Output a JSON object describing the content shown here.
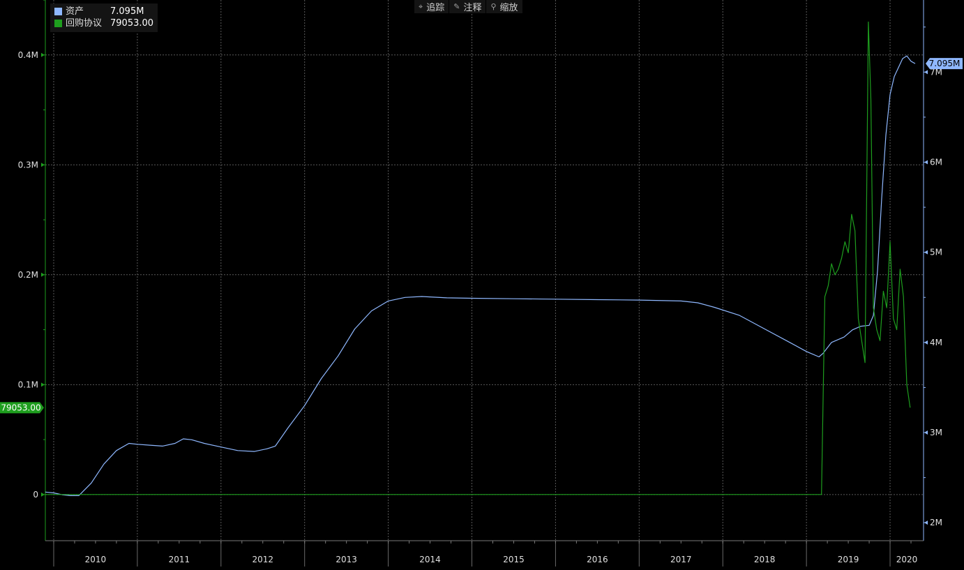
{
  "legend": {
    "items": [
      {
        "name": "资产",
        "value": "7.095M",
        "color": "#8fb8ff"
      },
      {
        "name": "回购协议",
        "value": "79053.00",
        "color": "#1e9e1e"
      }
    ]
  },
  "toolbar": {
    "crosshair_label": "追踪",
    "crosshair_icon": "crosshair-icon",
    "annotate_label": "注释",
    "annotate_icon": "pencil-icon",
    "zoom_label": "缩放",
    "zoom_icon": "magnifier-icon"
  },
  "chart_data": {
    "type": "line",
    "title": "",
    "x_ticks": [
      "2010",
      "2011",
      "2012",
      "2013",
      "2014",
      "2015",
      "2016",
      "2017",
      "2018",
      "2019",
      "2020"
    ],
    "xlim": [
      2009.9,
      2020.4
    ],
    "grid": true,
    "left_axis": {
      "ticks": [
        0,
        100000,
        200000,
        300000,
        400000
      ],
      "tick_labels": [
        "0",
        "0.1M",
        "0.2M",
        "0.3M",
        "0.4M"
      ],
      "ylim": [
        -42000,
        450000
      ],
      "color": "#1e9e1e",
      "last_value_label": "79053.00",
      "last_value": 79053
    },
    "right_axis": {
      "ticks": [
        2000000,
        3000000,
        4000000,
        5000000,
        6000000,
        7000000
      ],
      "tick_labels": [
        "2M",
        "3M",
        "4M",
        "5M",
        "6M",
        "7M"
      ],
      "ylim": [
        1800000,
        7800000
      ],
      "color": "#8fb8ff",
      "last_value_label": "7.095M",
      "last_value": 7095000
    },
    "series": [
      {
        "name": "资产",
        "axis": "right",
        "color": "#8fb8ff",
        "x": [
          2009.9,
          2010.0,
          2010.1,
          2010.2,
          2010.3,
          2010.45,
          2010.6,
          2010.75,
          2010.9,
          2011.0,
          2011.15,
          2011.3,
          2011.45,
          2011.55,
          2011.65,
          2011.8,
          2012.0,
          2012.2,
          2012.4,
          2012.55,
          2012.65,
          2012.8,
          2013.0,
          2013.2,
          2013.4,
          2013.6,
          2013.8,
          2014.0,
          2014.2,
          2014.4,
          2014.5,
          2014.7,
          2015.0,
          2015.5,
          2016.0,
          2016.5,
          2017.0,
          2017.5,
          2017.7,
          2017.9,
          2018.2,
          2018.5,
          2018.8,
          2019.0,
          2019.15,
          2019.2,
          2019.3,
          2019.45,
          2019.55,
          2019.65,
          2019.75,
          2019.8,
          2019.85,
          2019.9,
          2019.95,
          2020.0,
          2020.05,
          2020.1,
          2020.15,
          2020.2,
          2020.25,
          2020.3
        ],
        "y": [
          2340000,
          2330000,
          2310000,
          2300000,
          2300000,
          2440000,
          2650000,
          2800000,
          2880000,
          2870000,
          2860000,
          2850000,
          2880000,
          2930000,
          2920000,
          2880000,
          2840000,
          2800000,
          2790000,
          2820000,
          2850000,
          3050000,
          3300000,
          3600000,
          3850000,
          4150000,
          4350000,
          4460000,
          4500000,
          4510000,
          4505000,
          4495000,
          4490000,
          4485000,
          4480000,
          4475000,
          4470000,
          4460000,
          4440000,
          4390000,
          4300000,
          4150000,
          4000000,
          3900000,
          3840000,
          3880000,
          4000000,
          4060000,
          4140000,
          4180000,
          4190000,
          4300000,
          4800000,
          5600000,
          6300000,
          6750000,
          6950000,
          7050000,
          7150000,
          7180000,
          7120000,
          7095000
        ]
      },
      {
        "name": "回购协议",
        "axis": "left",
        "color": "#1e9e1e",
        "x": [
          2009.9,
          2019.18,
          2019.22,
          2019.26,
          2019.3,
          2019.34,
          2019.38,
          2019.42,
          2019.46,
          2019.5,
          2019.54,
          2019.58,
          2019.6,
          2019.62,
          2019.66,
          2019.7,
          2019.74,
          2019.77,
          2019.8,
          2019.84,
          2019.88,
          2019.92,
          2019.96,
          2020.0,
          2020.04,
          2020.08,
          2020.12,
          2020.16,
          2020.2,
          2020.24
        ],
        "y": [
          0,
          0,
          180000,
          190000,
          210000,
          200000,
          205000,
          215000,
          230000,
          220000,
          255000,
          240000,
          200000,
          160000,
          140000,
          120000,
          430000,
          360000,
          170000,
          150000,
          140000,
          185000,
          170000,
          230000,
          160000,
          150000,
          205000,
          180000,
          100000,
          79053
        ]
      }
    ]
  }
}
